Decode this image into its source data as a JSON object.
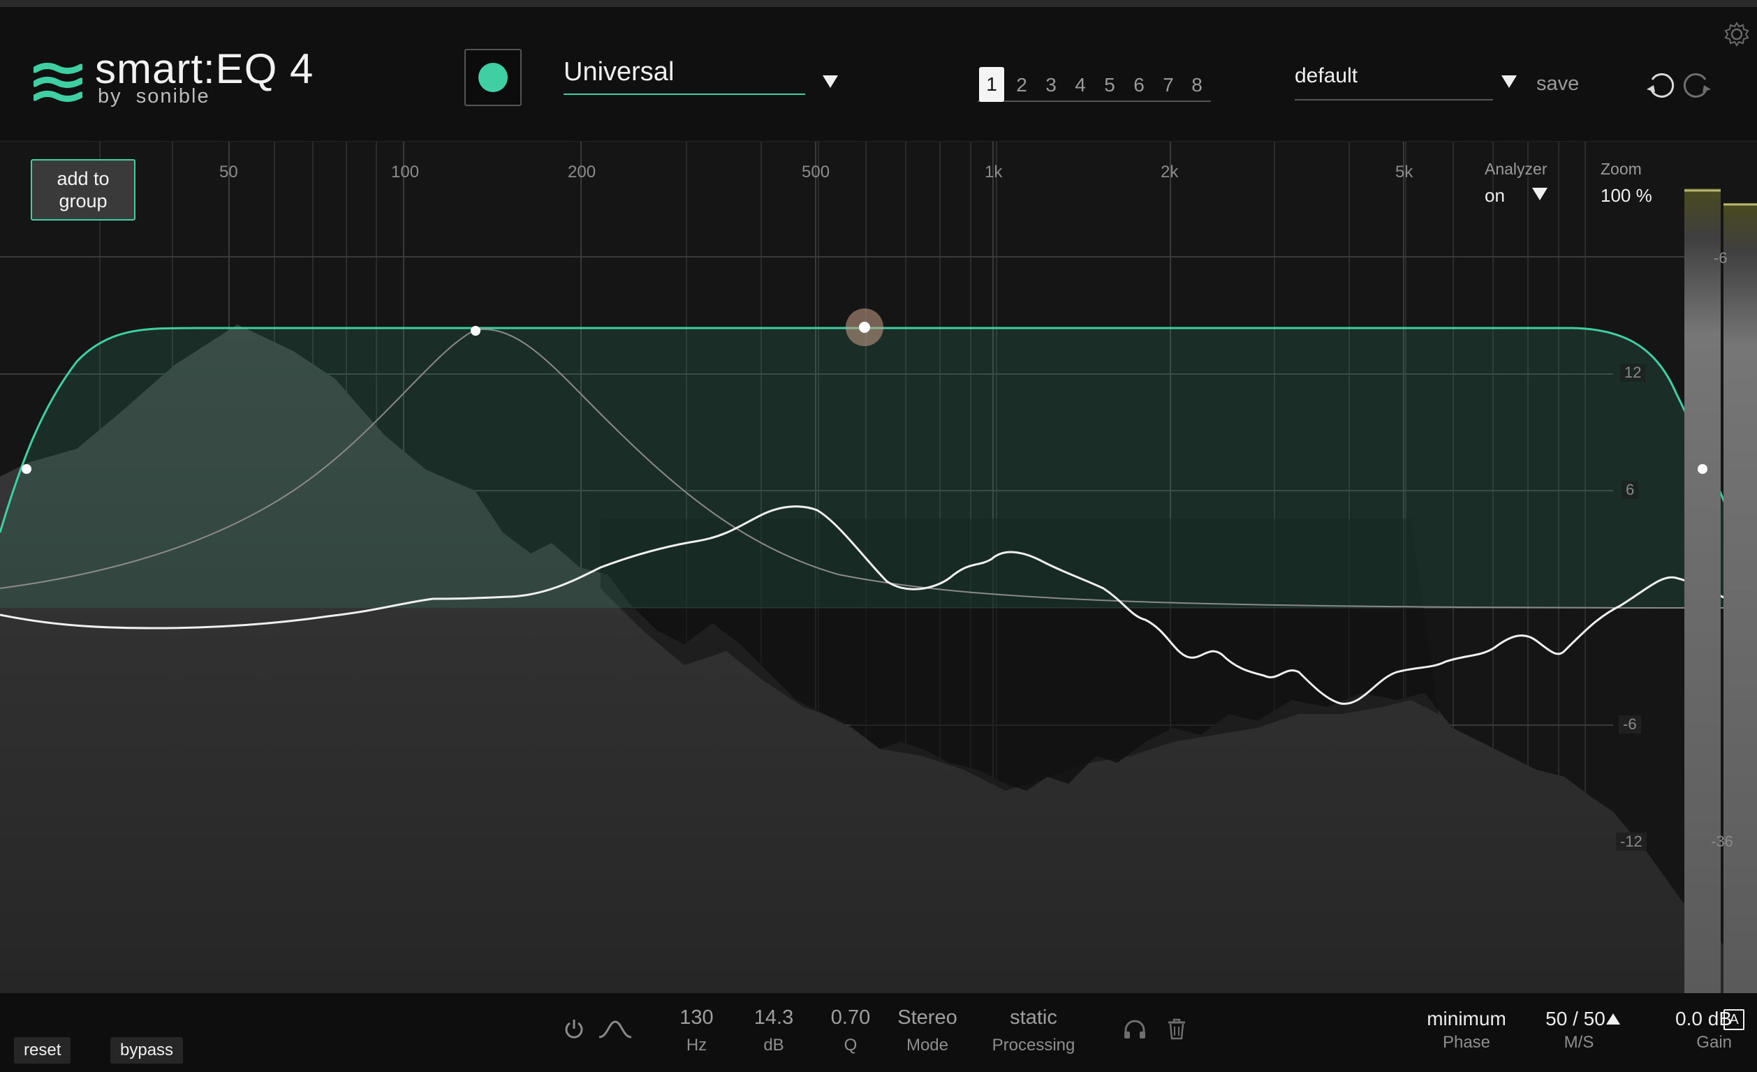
{
  "app": {
    "title": "smart:EQ 4",
    "by": "by",
    "brand": "sonible"
  },
  "header": {
    "profile": "Universal",
    "snapshots": [
      "1",
      "2",
      "3",
      "4",
      "5",
      "6",
      "7",
      "8"
    ],
    "active_snapshot": "1",
    "preset": "default",
    "save_label": "save"
  },
  "plot": {
    "add_group_line1": "add to",
    "add_group_line2": "group",
    "freq_labels": [
      "50",
      "100",
      "200",
      "500",
      "1k",
      "2k",
      "5k"
    ],
    "db_labels": [
      "12",
      "6",
      "-6",
      "-12"
    ],
    "meter_labels": [
      "-6",
      "-36"
    ],
    "analyzer_label": "Analyzer",
    "analyzer_value": "on",
    "zoom_label": "Zoom",
    "zoom_value": "100 %"
  },
  "band": {
    "freq_value": "130",
    "freq_unit": "Hz",
    "gain_value": "14.3",
    "gain_unit": "dB",
    "q_value": "0.70",
    "q_unit": "Q",
    "mode_value": "Stereo",
    "mode_label": "Mode",
    "processing_value": "static",
    "processing_label": "Processing"
  },
  "footer": {
    "reset_label": "reset",
    "bypass_label": "bypass",
    "phase_value": "minimum",
    "phase_label": "Phase",
    "ms_value": "50 / 50",
    "ms_label": "M/S",
    "gain_value": "0.0 dB",
    "gain_auto": "A",
    "gain_label": "Gain"
  },
  "colors": {
    "accent": "#3fcfa2",
    "background": "#101010",
    "plot_bg": "#151515"
  },
  "icons": [
    "logo-waves-icon",
    "gear-icon",
    "undo-icon",
    "redo-icon",
    "dropdown-arrow-icon",
    "power-icon",
    "bell-filter-icon",
    "headphones-icon",
    "trash-icon"
  ]
}
